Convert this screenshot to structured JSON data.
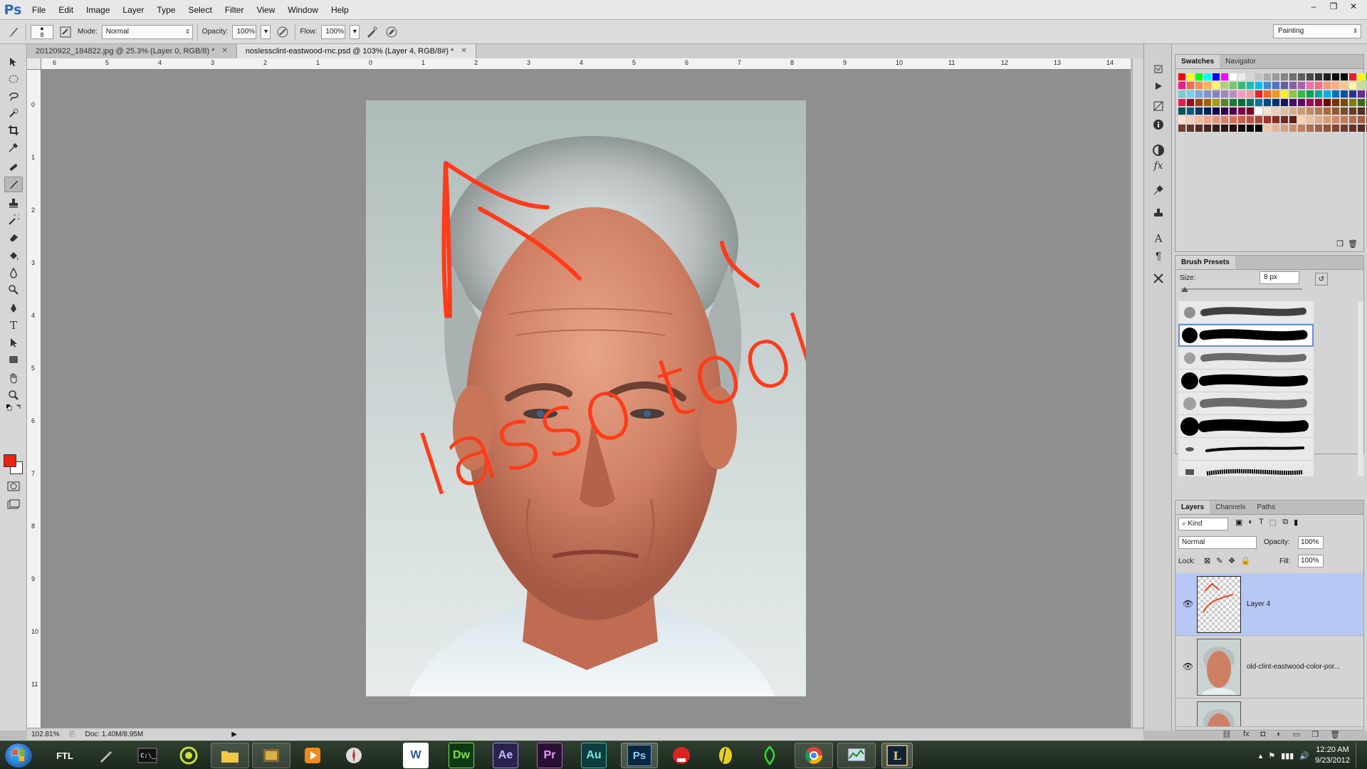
{
  "app": {
    "logo": "Ps"
  },
  "menu": [
    "File",
    "Edit",
    "Image",
    "Layer",
    "Type",
    "Select",
    "Filter",
    "View",
    "Window",
    "Help"
  ],
  "window_controls": {
    "minimize": "–",
    "restore": "❐",
    "close": "✕"
  },
  "options_bar": {
    "brush_size": "8",
    "mode_label": "Mode:",
    "mode_value": "Normal",
    "opacity_label": "Opacity:",
    "opacity_value": "100%",
    "flow_label": "Flow:",
    "flow_value": "100%",
    "workspace": "Painting"
  },
  "doc_tabs": [
    {
      "label": "20120922_184822.jpg @ 25.3% (Layer 0, RGB/8) *",
      "active": false
    },
    {
      "label": "noslessclint-eastwood-rnc.psd @ 103% (Layer 4, RGB/8#) *",
      "active": true
    }
  ],
  "ruler_h": [
    "6",
    "5",
    "4",
    "3",
    "2",
    "1",
    "0",
    "1",
    "2",
    "3",
    "4",
    "5",
    "6",
    "7",
    "8",
    "9",
    "10",
    "11",
    "12",
    "13",
    "14"
  ],
  "ruler_v": [
    "0",
    "1",
    "2",
    "3",
    "4",
    "5",
    "6",
    "7",
    "8",
    "9",
    "10",
    "11"
  ],
  "status": {
    "zoom": "102.81%",
    "doc": "Doc: 1.40M/8.95M"
  },
  "annotation_text": "lasso tool",
  "swatches_panel": {
    "tabs": [
      "Swatches",
      "Navigator"
    ],
    "active_tab": "Swatches",
    "colors": [
      "#ff0000",
      "#ffff00",
      "#00ff00",
      "#00ffff",
      "#0000ff",
      "#ff00ff",
      "#ffffff",
      "#ebebeb",
      "#d6d6d6",
      "#c2c2c2",
      "#adadad",
      "#999999",
      "#858585",
      "#707070",
      "#5c5c5c",
      "#474747",
      "#333333",
      "#1f1f1f",
      "#0a0a0a",
      "#000000",
      "#ee1d24",
      "#fff200",
      "#00a650",
      "#00adef",
      "#ee1d80",
      "#f26c4f",
      "#f68e55",
      "#fbaf5c",
      "#fff467",
      "#acd372",
      "#7cc576",
      "#3bb878",
      "#1abbb4",
      "#00bff3",
      "#438ccb",
      "#5574b9",
      "#605ca8",
      "#855fa8",
      "#a763a8",
      "#f06ea9",
      "#f26d7d",
      "#f7977a",
      "#fbad82",
      "#fdc68c",
      "#fff799",
      "#c6df9c",
      "#a3d39c",
      "#82ca9c",
      "#7accc8",
      "#6dcff6",
      "#7da7d9",
      "#8393ca",
      "#8781bd",
      "#a186be",
      "#bd8cbf",
      "#f49ac1",
      "#f5989d",
      "#ed1c24",
      "#f26522",
      "#f7941d",
      "#fff200",
      "#8dc63f",
      "#39b54a",
      "#00a651",
      "#00a99d",
      "#00aeef",
      "#0072bc",
      "#0054a6",
      "#2e3192",
      "#662d91",
      "#92278f",
      "#ec008c",
      "#ed145b",
      "#9e0b0f",
      "#a0410d",
      "#a3620a",
      "#aba000",
      "#598527",
      "#1a7b30",
      "#007236",
      "#00746b",
      "#0076a3",
      "#004b80",
      "#003471",
      "#1b1464",
      "#440e62",
      "#630460",
      "#9e005d",
      "#9e0039",
      "#790000",
      "#7b2e00",
      "#7d4900",
      "#827b00",
      "#406618",
      "#005e20",
      "#005826",
      "#005952",
      "#005b7f",
      "#003663",
      "#002157",
      "#0d004c",
      "#32004b",
      "#4b0049",
      "#7b0046",
      "#7a0026",
      "#ffffff",
      "#f2e2d1",
      "#e8d0b8",
      "#ddbfa0",
      "#d4ae8a",
      "#c99c74",
      "#bf8b60",
      "#b47a4e",
      "#a66a3e",
      "#8f5a33",
      "#7a4b2a",
      "#653d22",
      "#50301b",
      "#3d2415",
      "#2a1910",
      "#fde0cf",
      "#f9cdb7",
      "#f4b9a0",
      "#eea58b",
      "#e89277",
      "#df8066",
      "#d56f57",
      "#c9604a",
      "#bb523f",
      "#ab4536",
      "#99392e",
      "#862f28",
      "#722622",
      "#5e1e1d",
      "#f5d3b8",
      "#ecc1a1",
      "#e2af8c",
      "#d79d79",
      "#cc8c68",
      "#c07c5a",
      "#b36d4e",
      "#a46043",
      "#95543a",
      "#864933",
      "#773e2d",
      "#673427",
      "#572b21",
      "#47231c",
      "#3a1d17",
      "#2e1712",
      "#22110e",
      "#170b09",
      "#0d0605",
      "#000000",
      "#efc7a8",
      "#e4b393",
      "#d8a07f",
      "#cc8e6d",
      "#bf7d5d",
      "#b16d4f",
      "#a25f44",
      "#93523a",
      "#844632",
      "#753c2b",
      "#663225",
      "#57291f",
      "#49221a",
      "#3b1b15"
    ]
  },
  "brush_panel": {
    "title": "Brush Presets",
    "size_label": "Size:",
    "size_value": "8 px"
  },
  "layers_panel": {
    "tabs": [
      "Layers",
      "Channels",
      "Paths"
    ],
    "active_tab": "Layers",
    "kind_label": "Kind",
    "blend_mode": "Normal",
    "opacity_label": "Opacity:",
    "opacity_value": "100%",
    "lock_label": "Lock:",
    "fill_label": "Fill:",
    "fill_value": "100%",
    "layers": [
      {
        "name": "Layer 4",
        "selected": true
      },
      {
        "name": "old-clint-eastwood-color-por...",
        "selected": false
      },
      {
        "name": "",
        "selected": false
      }
    ]
  },
  "taskbar": {
    "apps": [
      "FTL",
      "",
      "",
      "",
      "",
      "",
      "",
      "",
      "W",
      "Dw",
      "Ae",
      "Pr",
      "Au",
      "Ps",
      "",
      "",
      "",
      "",
      "",
      "L"
    ],
    "clock_time": "12:20 AM",
    "clock_date": "9/23/2012"
  }
}
